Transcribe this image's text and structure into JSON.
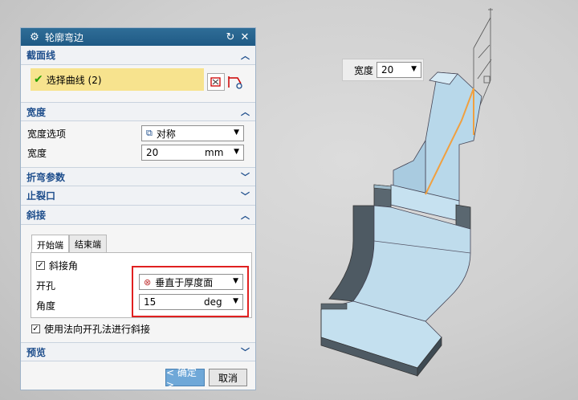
{
  "dialog": {
    "title": "轮廓弯边",
    "sections": {
      "section_curve": "截面线",
      "select_curve": "选择曲线 (2)",
      "width": "宽度",
      "bend_params": "折弯参数",
      "relief": "止裂口",
      "miter": "斜接",
      "preview": "预览"
    },
    "width_option_label": "宽度选项",
    "width_option_value": "对称",
    "width_label": "宽度",
    "width_value": "20",
    "width_unit": "mm",
    "tabs": [
      "开始端",
      "结束端"
    ],
    "miter_angle_checkbox": "斜接角",
    "hole_label": "开孔",
    "hole_value": "垂直于厚度面",
    "angle_label": "角度",
    "angle_value": "15",
    "angle_unit": "deg",
    "normal_cut_checkbox": "使用法向开孔法进行斜接",
    "ok_button": "< 确定 >",
    "cancel_button": "取消"
  },
  "floating": {
    "label": "宽度",
    "value": "20"
  },
  "colors": {
    "title_bar": "#235e8a",
    "section_label": "#1e4e8c",
    "selected_row": "#f7e38e",
    "highlight_box": "#e02020",
    "sketch_curve": "#f0a040"
  }
}
